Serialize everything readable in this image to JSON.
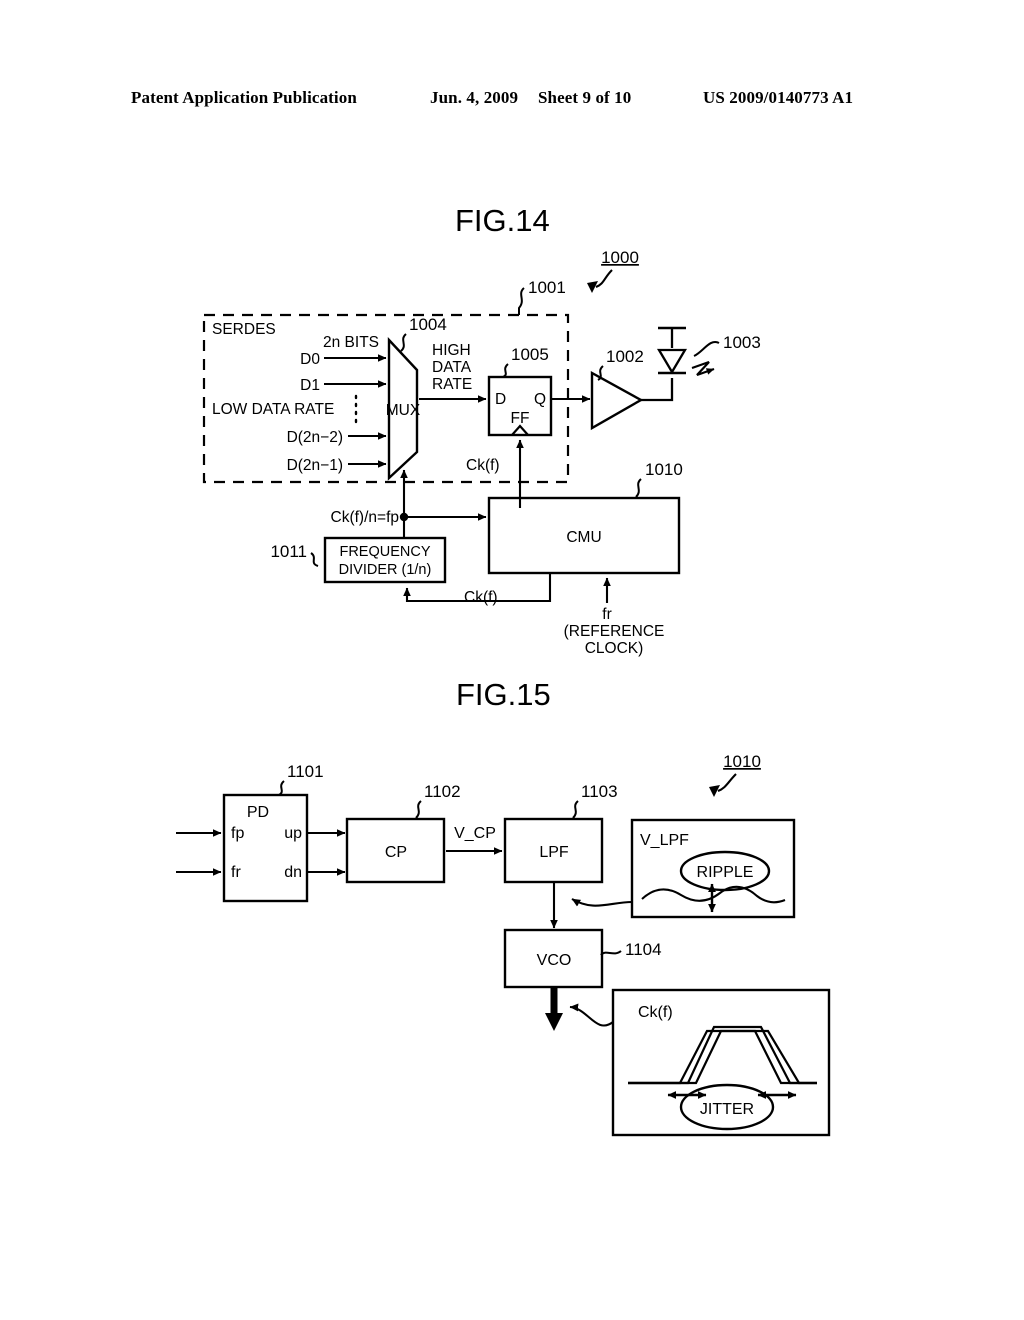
{
  "header": {
    "publication": "Patent Application Publication",
    "date": "Jun. 4, 2009",
    "sheet": "Sheet 9 of 10",
    "patent_number": "US 2009/0140773 A1"
  },
  "fig14": {
    "title": "FIG.14",
    "ref_system": "1000",
    "ref_serdes": "1001",
    "ref_amp": "1002",
    "ref_laser": "1003",
    "ref_mux": "1004",
    "ref_ff": "1005",
    "ref_cmu": "1010",
    "ref_divider": "1011",
    "serdes_label": "SERDES",
    "bits_label": "2n BITS",
    "input_d0": "D0",
    "input_d1": "D1",
    "input_d2n2": "D(2n−2)",
    "input_d2n1": "D(2n−1)",
    "low_rate_label": "LOW DATA RATE",
    "mux_label": "MUX",
    "high_rate_line1": "HIGH",
    "high_rate_line2": "DATA",
    "high_rate_line3": "RATE",
    "ff_d": "D",
    "ff_q": "Q",
    "ff_label": "FF",
    "ff_clock": "Ck(f)",
    "fp_label": "Ck(f)/n=fp",
    "divider_line1": "FREQUENCY",
    "divider_line2": "DIVIDER (1/n)",
    "cmu_label": "CMU",
    "divider_clock": "Ck(f)",
    "fr_label": "fr",
    "fr_line2": "(REFERENCE",
    "fr_line3": "CLOCK)"
  },
  "fig15": {
    "title": "FIG.15",
    "ref_pd": "1101",
    "ref_cp": "1102",
    "ref_lpf": "1103",
    "ref_vco": "1104",
    "ref_cmu": "1010",
    "pd_label": "PD",
    "pd_in_fp": "fp",
    "pd_in_fr": "fr",
    "pd_out_up": "up",
    "pd_out_dn": "dn",
    "cp_label": "CP",
    "v_cp_label": "V_CP",
    "lpf_label": "LPF",
    "vco_label": "VCO",
    "v_lpf_label": "V_LPF",
    "ripple_label": "RIPPLE",
    "ckf_label": "Ck(f)",
    "jitter_label": "JITTER"
  }
}
